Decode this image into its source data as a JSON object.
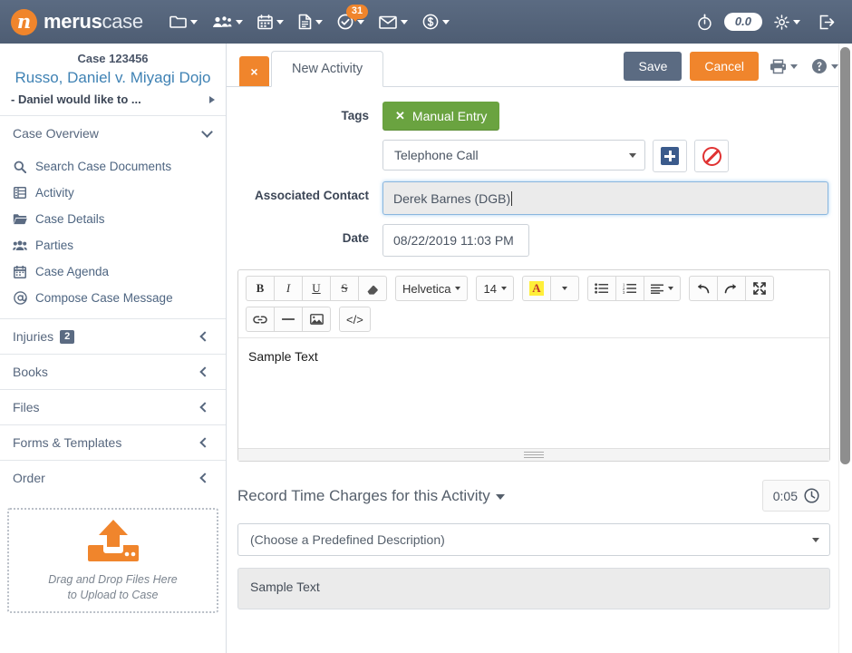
{
  "topnav": {
    "brand_bold": "merus",
    "brand_light": "case",
    "brand_mark": "n",
    "items": [
      {
        "icon": "folder-icon",
        "name": "folder-menu"
      },
      {
        "icon": "people-icon",
        "name": "contacts-menu"
      },
      {
        "icon": "calendar-icon",
        "name": "calendar-menu"
      },
      {
        "icon": "document-icon",
        "name": "documents-menu"
      },
      {
        "icon": "check-circle-icon",
        "name": "tasks-menu",
        "badge": "31"
      },
      {
        "icon": "envelope-icon",
        "name": "mail-menu"
      },
      {
        "icon": "dollar-circle-icon",
        "name": "billing-menu"
      }
    ],
    "stopwatch_icon": "stopwatch-icon",
    "timer_value": "0.0",
    "gear_icon": "gear-icon",
    "logout_icon": "logout-icon"
  },
  "sidebar": {
    "case_number": "Case 123456",
    "case_title": "Russo, Daniel v. Miyagi Dojo",
    "case_subtitle": "- Daniel would like to ...",
    "overview_label": "Case Overview",
    "nav": [
      {
        "label": "Search Case Documents",
        "icon": "search-icon"
      },
      {
        "label": "Activity",
        "icon": "list-table-icon"
      },
      {
        "label": "Case Details",
        "icon": "folder-open-icon"
      },
      {
        "label": "Parties",
        "icon": "people-group-icon"
      },
      {
        "label": "Case Agenda",
        "icon": "calendar-icon"
      },
      {
        "label": "Compose Case Message",
        "icon": "at-sign-icon"
      }
    ],
    "sections": [
      {
        "label": "Injuries",
        "badge": "2"
      },
      {
        "label": "Books",
        "badge": ""
      },
      {
        "label": "Files",
        "badge": ""
      },
      {
        "label": "Forms & Templates",
        "badge": ""
      },
      {
        "label": "Order",
        "badge": ""
      }
    ],
    "dropzone": {
      "icon": "upload-icon",
      "line1": "Drag and Drop Files Here",
      "line2": "to Upload to Case"
    }
  },
  "tabbar": {
    "close_label": "×",
    "tab_label": "New Activity",
    "save_label": "Save",
    "cancel_label": "Cancel",
    "print_icon": "printer-icon",
    "help_icon": "help-circle-icon"
  },
  "form": {
    "tags_label": "Tags",
    "tag_chip": "Manual Entry",
    "tag_chip_remove": "✕",
    "type_select": "Telephone Call",
    "add_button_icon": "plus-icon",
    "block_button_icon": "no-entry-icon",
    "contact_label": "Associated Contact",
    "contact_value": "Derek Barnes (DGB)",
    "date_label": "Date",
    "date_value": "08/22/2019 11:03 PM"
  },
  "editor": {
    "toolbar_row1": [
      {
        "label": "B",
        "name": "bold-button"
      },
      {
        "label": "I",
        "name": "italic-button"
      },
      {
        "label": "U",
        "name": "underline-button"
      },
      {
        "label": "S",
        "name": "strikethrough-button"
      },
      {
        "label": "◥",
        "name": "clear-format-icon"
      }
    ],
    "font_family": "Helvetica",
    "font_size": "14",
    "text_color_label": "A",
    "list_buttons": [
      {
        "name": "unordered-list-button"
      },
      {
        "name": "ordered-list-button"
      },
      {
        "name": "align-button"
      }
    ],
    "history_buttons": [
      {
        "name": "undo-button"
      },
      {
        "name": "redo-button"
      },
      {
        "name": "fullscreen-button"
      }
    ],
    "toolbar_row2": [
      {
        "name": "link-button"
      },
      {
        "name": "horizontal-rule-button"
      },
      {
        "name": "image-button"
      },
      {
        "label": "</>",
        "name": "code-view-button"
      }
    ],
    "body_text": "Sample Text"
  },
  "time_charges": {
    "title": "Record Time Charges for this Activity",
    "timer_value": "0:05",
    "clock_icon": "clock-icon",
    "description_select": "(Choose a Predefined Description)",
    "note_text": "Sample Text"
  },
  "colors": {
    "nav_bg": "#4e5d73",
    "accent_orange": "#f0852c",
    "tag_green": "#6aa340",
    "link_blue": "#3f82b4",
    "danger_red": "#e03232"
  }
}
